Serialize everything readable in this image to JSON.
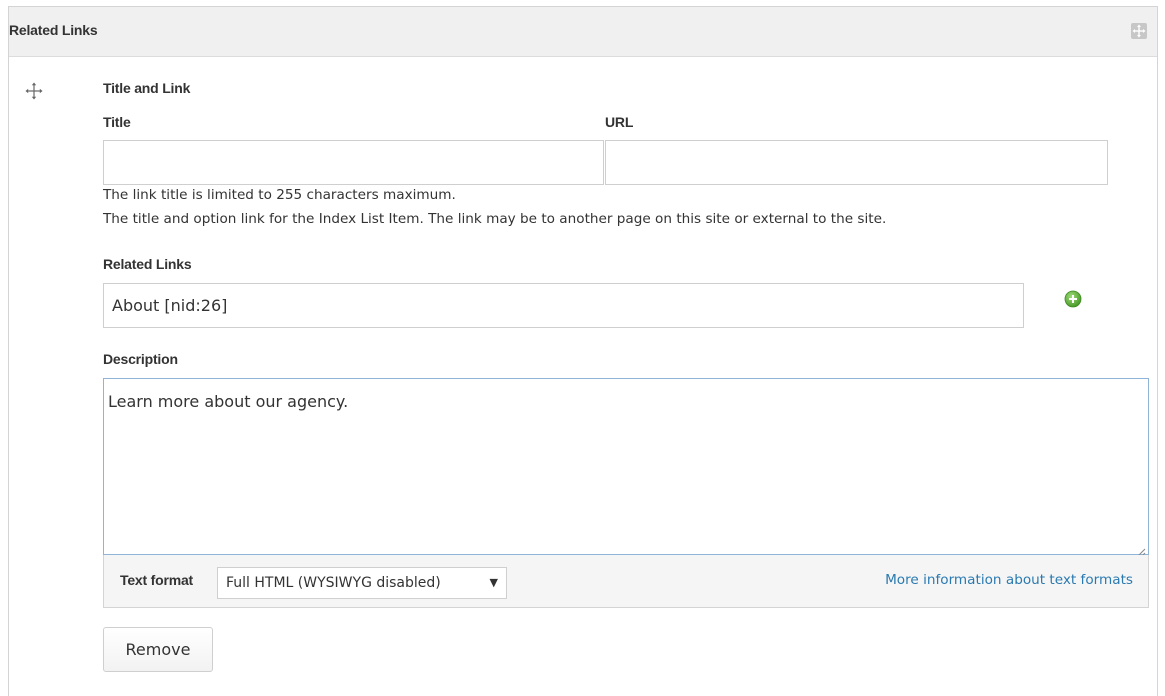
{
  "panel": {
    "title": "Related Links"
  },
  "title_and_link": {
    "heading": "Title and Link",
    "title_label": "Title",
    "title_value": "",
    "url_label": "URL",
    "url_value": "",
    "help_line_1": "The link title is limited to 255 characters maximum.",
    "help_line_2": "The title and option link for the Index List Item. The link may be to another page on this site or external to the site."
  },
  "related_links": {
    "label": "Related Links",
    "value": "About [nid:26]"
  },
  "description": {
    "label": "Description",
    "value": "Learn more about our agency."
  },
  "text_format": {
    "label": "Text format",
    "selected": "Full HTML (WYSIWYG disabled)",
    "arrow": "▼",
    "more_info_link": "More information about text formats"
  },
  "actions": {
    "remove_label": "Remove"
  },
  "colors": {
    "link": "#2a7ab0",
    "add_green": "#5aa832",
    "focus_border": "#8fb4d8"
  },
  "icons": {
    "expand": "expand-arrows-icon",
    "drag": "drag-handle-icon",
    "add": "add-circle-icon",
    "resize": "resize-grip-icon"
  }
}
